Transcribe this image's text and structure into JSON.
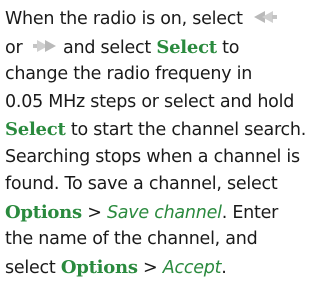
{
  "lines": {
    "l1_text": "When the radio is on, select ",
    "l2_or": "or ",
    "l2_rest": " and select ",
    "l2_kw": "Select",
    "l2_tail": " to",
    "l3": "change the radio frequeny in",
    "l4": "0.05 MHz steps or select and hold",
    "l5_kw": "Select",
    "l5_rest": " to start the channel search.",
    "l6": "Searching stops when a channel is",
    "l7": "found. To save a channel, select",
    "l8_kw": "Options",
    "l8_sep": " > ",
    "l8_opt": "Save channel",
    "l8_tail": ". Enter",
    "l9": "the name of the channel, and",
    "l10_pre": "select ",
    "l10_kw": "Options",
    "l10_sep": " > ",
    "l10_opt": "Accept",
    "l10_tail": "."
  },
  "icons": {
    "left": "scroll-left-icon",
    "right": "scroll-right-icon"
  },
  "colors": {
    "keyword": "#2a8a3e",
    "text": "#1a1a1a",
    "icon_gray": "#b9b9b9"
  }
}
